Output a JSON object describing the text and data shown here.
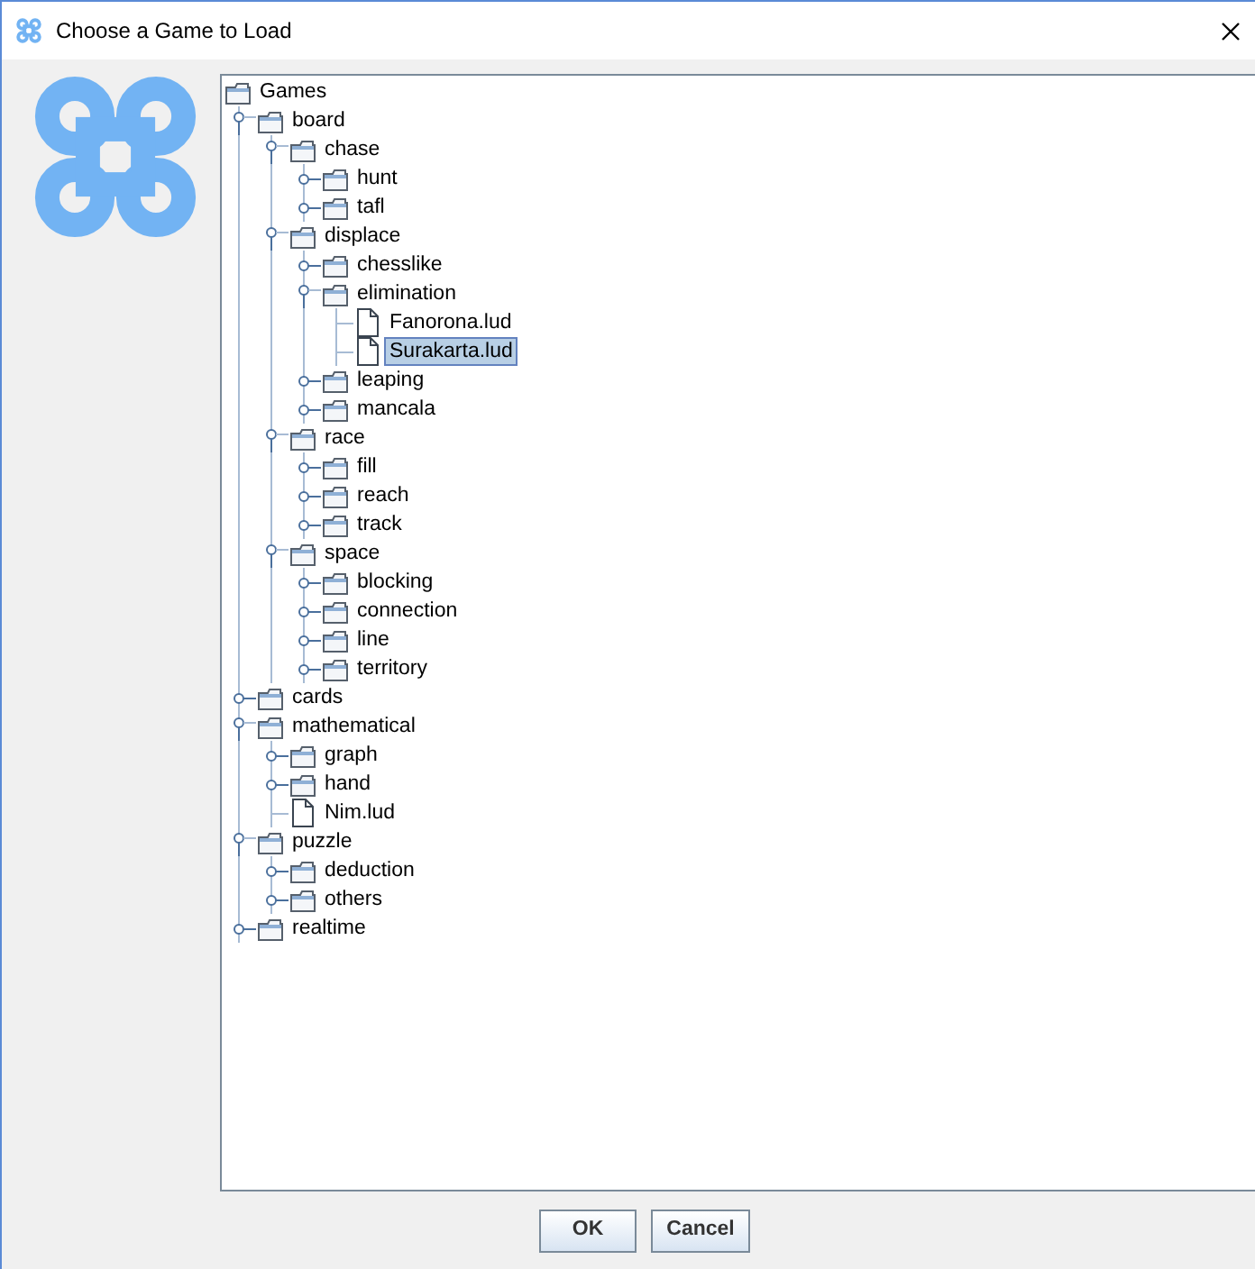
{
  "window": {
    "title": "Choose a Game to Load"
  },
  "tree": {
    "label": "Games",
    "kind": "folder",
    "selected": false,
    "children": [
      {
        "label": "board",
        "kind": "folder",
        "expanded": true,
        "selected": false,
        "children": [
          {
            "label": "chase",
            "kind": "folder",
            "expanded": true,
            "selected": false,
            "children": [
              {
                "label": "hunt",
                "kind": "folder",
                "expanded": false,
                "selected": false
              },
              {
                "label": "tafl",
                "kind": "folder",
                "expanded": false,
                "selected": false
              }
            ]
          },
          {
            "label": "displace",
            "kind": "folder",
            "expanded": true,
            "selected": false,
            "children": [
              {
                "label": "chesslike",
                "kind": "folder",
                "expanded": false,
                "selected": false
              },
              {
                "label": "elimination",
                "kind": "folder",
                "expanded": true,
                "selected": false,
                "children": [
                  {
                    "label": "Fanorona.lud",
                    "kind": "file",
                    "selected": false
                  },
                  {
                    "label": "Surakarta.lud",
                    "kind": "file",
                    "selected": true
                  }
                ]
              },
              {
                "label": "leaping",
                "kind": "folder",
                "expanded": false,
                "selected": false
              },
              {
                "label": "mancala",
                "kind": "folder",
                "expanded": false,
                "selected": false
              }
            ]
          },
          {
            "label": "race",
            "kind": "folder",
            "expanded": true,
            "selected": false,
            "children": [
              {
                "label": "fill",
                "kind": "folder",
                "expanded": false,
                "selected": false
              },
              {
                "label": "reach",
                "kind": "folder",
                "expanded": false,
                "selected": false
              },
              {
                "label": "track",
                "kind": "folder",
                "expanded": false,
                "selected": false
              }
            ]
          },
          {
            "label": "space",
            "kind": "folder",
            "expanded": true,
            "selected": false,
            "children": [
              {
                "label": "blocking",
                "kind": "folder",
                "expanded": false,
                "selected": false
              },
              {
                "label": "connection",
                "kind": "folder",
                "expanded": false,
                "selected": false
              },
              {
                "label": "line",
                "kind": "folder",
                "expanded": false,
                "selected": false
              },
              {
                "label": "territory",
                "kind": "folder",
                "expanded": false,
                "selected": false
              }
            ]
          }
        ]
      },
      {
        "label": "cards",
        "kind": "folder",
        "expanded": false,
        "selected": false
      },
      {
        "label": "mathematical",
        "kind": "folder",
        "expanded": true,
        "selected": false,
        "children": [
          {
            "label": "graph",
            "kind": "folder",
            "expanded": false,
            "selected": false
          },
          {
            "label": "hand",
            "kind": "folder",
            "expanded": false,
            "selected": false
          },
          {
            "label": "Nim.lud",
            "kind": "file",
            "selected": false
          }
        ]
      },
      {
        "label": "puzzle",
        "kind": "folder",
        "expanded": true,
        "selected": false,
        "children": [
          {
            "label": "deduction",
            "kind": "folder",
            "expanded": false,
            "selected": false
          },
          {
            "label": "others",
            "kind": "folder",
            "expanded": false,
            "selected": false
          }
        ]
      },
      {
        "label": "realtime",
        "kind": "folder",
        "expanded": false,
        "selected": false
      }
    ]
  },
  "buttons": [
    "OK",
    "Cancel"
  ]
}
